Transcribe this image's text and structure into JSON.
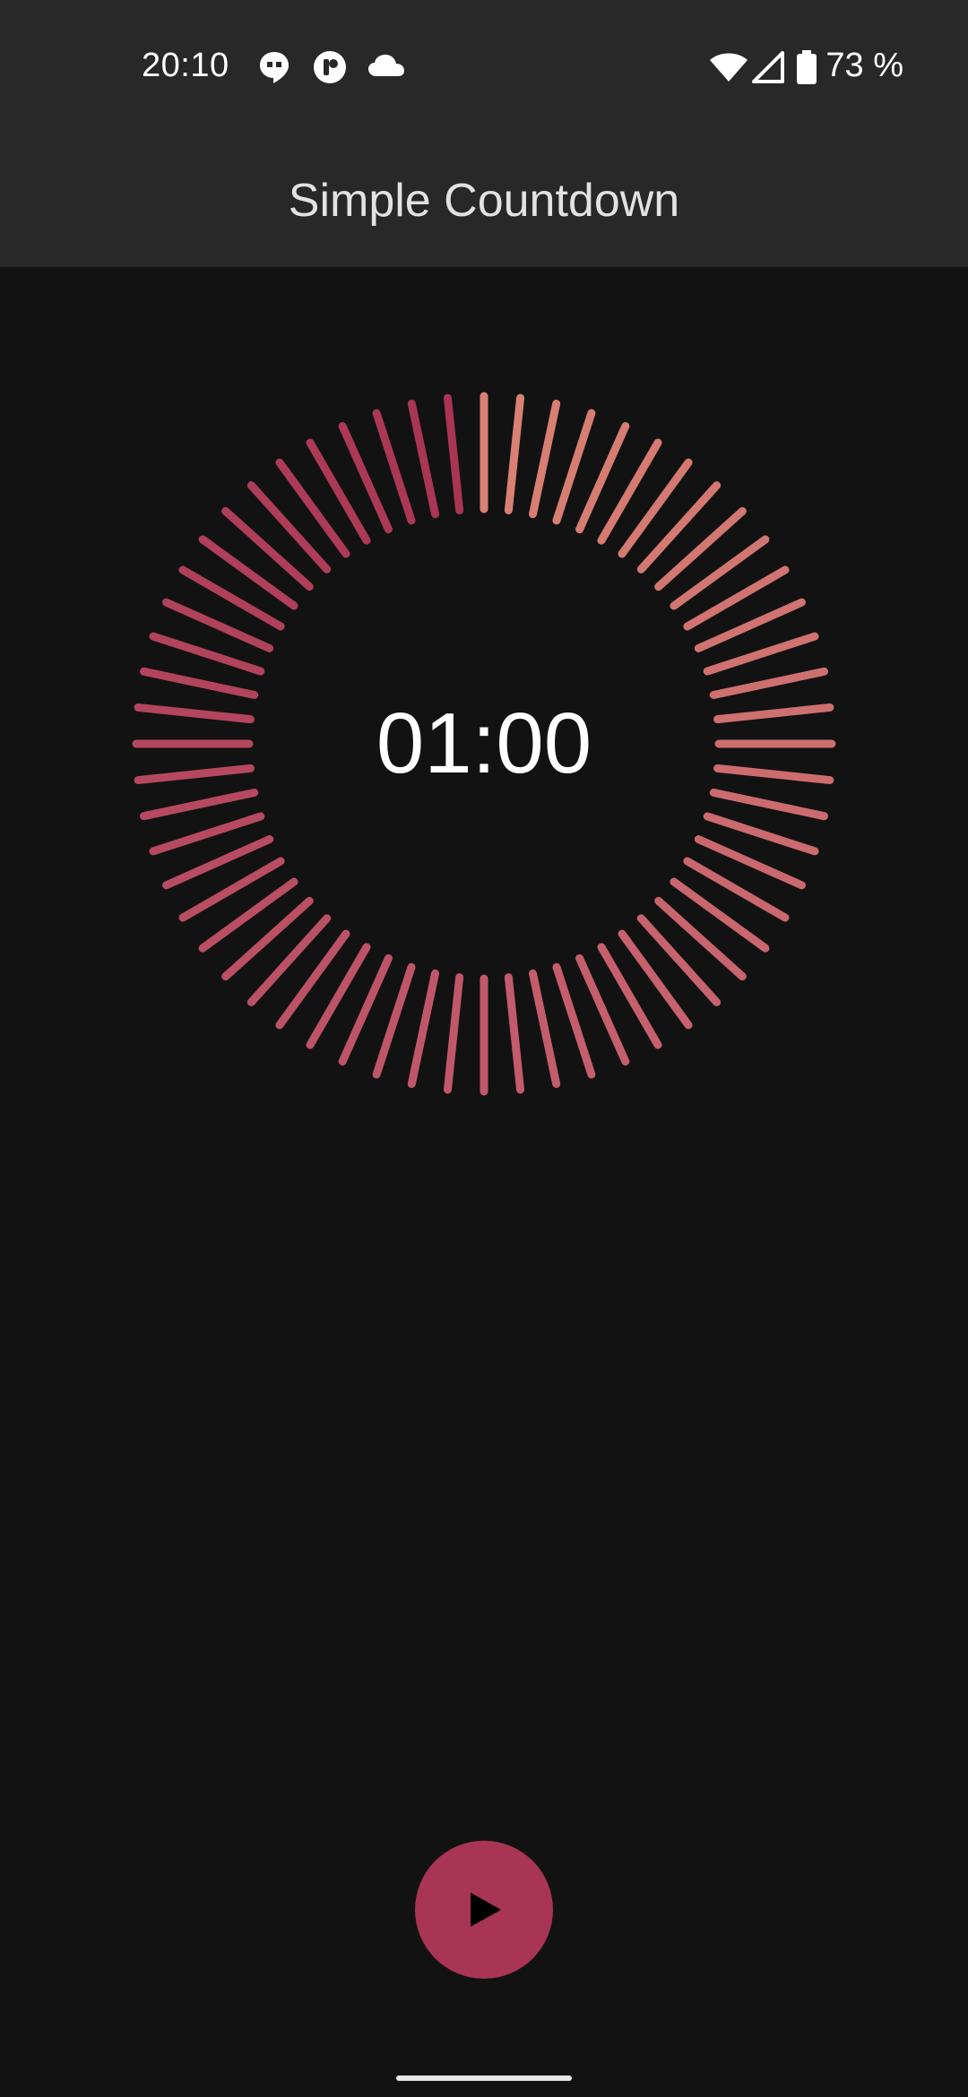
{
  "status_bar": {
    "time": "20:10",
    "notification_icons": [
      "hangouts-icon",
      "tasker-icon",
      "cloud-icon"
    ],
    "system_icons": [
      "wifi-icon",
      "cellular-signal-icon",
      "battery-icon"
    ],
    "battery_text": "73 %"
  },
  "app_bar": {
    "title": "Simple Countdown"
  },
  "timer": {
    "display": "01:00",
    "tick_count": 60,
    "color_start": "#d98274",
    "color_mid": "#c25a6b",
    "color_end": "#a83553"
  },
  "controls": {
    "play_button_color": "#a83553",
    "play_icon": "play-icon"
  },
  "colors": {
    "background": "#121212",
    "app_bar": "#282828",
    "title_text": "#e2e2e2"
  }
}
